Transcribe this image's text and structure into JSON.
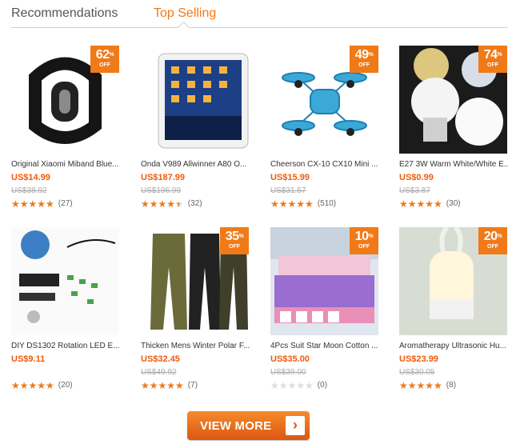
{
  "tabs": [
    {
      "label": "Recommendations",
      "active": false
    },
    {
      "label": "Top Selling",
      "active": true
    }
  ],
  "colors": {
    "accent": "#f07818",
    "price": "#f05a0a",
    "star": "#f07a18"
  },
  "badge_off_label": "OFF",
  "products": [
    {
      "name": "Original Xiaomi Miband Blue...",
      "price": "US$14.99",
      "old_price": "US$38.92",
      "discount": "62",
      "rating": 5,
      "reviews": "(27)",
      "image": "fitness-band"
    },
    {
      "name": "Onda V989 Allwinner A80 O...",
      "price": "US$187.99",
      "old_price": "US$196.99",
      "discount": "",
      "rating": 4.5,
      "reviews": "(32)",
      "image": "tablet"
    },
    {
      "name": "Cheerson CX-10 CX10 Mini ...",
      "price": "US$15.99",
      "old_price": "US$31.57",
      "discount": "49",
      "rating": 5,
      "reviews": "(510)",
      "image": "drone"
    },
    {
      "name": "E27 3W Warm White/White E...",
      "price": "US$0.99",
      "old_price": "US$3.87",
      "discount": "74",
      "rating": 5,
      "reviews": "(30)",
      "image": "led-bulb"
    },
    {
      "name": "DIY DS1302 Rotation LED E...",
      "price": "US$9.11",
      "old_price": "",
      "discount": "",
      "rating": 5,
      "reviews": "(20)",
      "image": "led-kit"
    },
    {
      "name": "Thicken Mens Winter Polar F...",
      "price": "US$32.45",
      "old_price": "US$49.92",
      "discount": "35",
      "rating": 5,
      "reviews": "(7)",
      "image": "cargo-pants"
    },
    {
      "name": "4Pcs Suit Star Moon Cotton ...",
      "price": "US$35.00",
      "old_price": "US$39.00",
      "discount": "10",
      "rating": 0,
      "reviews": "(0)",
      "image": "bedding-set"
    },
    {
      "name": "Aromatherapy Ultrasonic Hu...",
      "price": "US$23.99",
      "old_price": "US$30.05",
      "discount": "20",
      "rating": 5,
      "reviews": "(8)",
      "image": "humidifier"
    }
  ],
  "view_more": {
    "label": "VIEW MORE",
    "arrow_icon": "chevron-right-icon"
  }
}
